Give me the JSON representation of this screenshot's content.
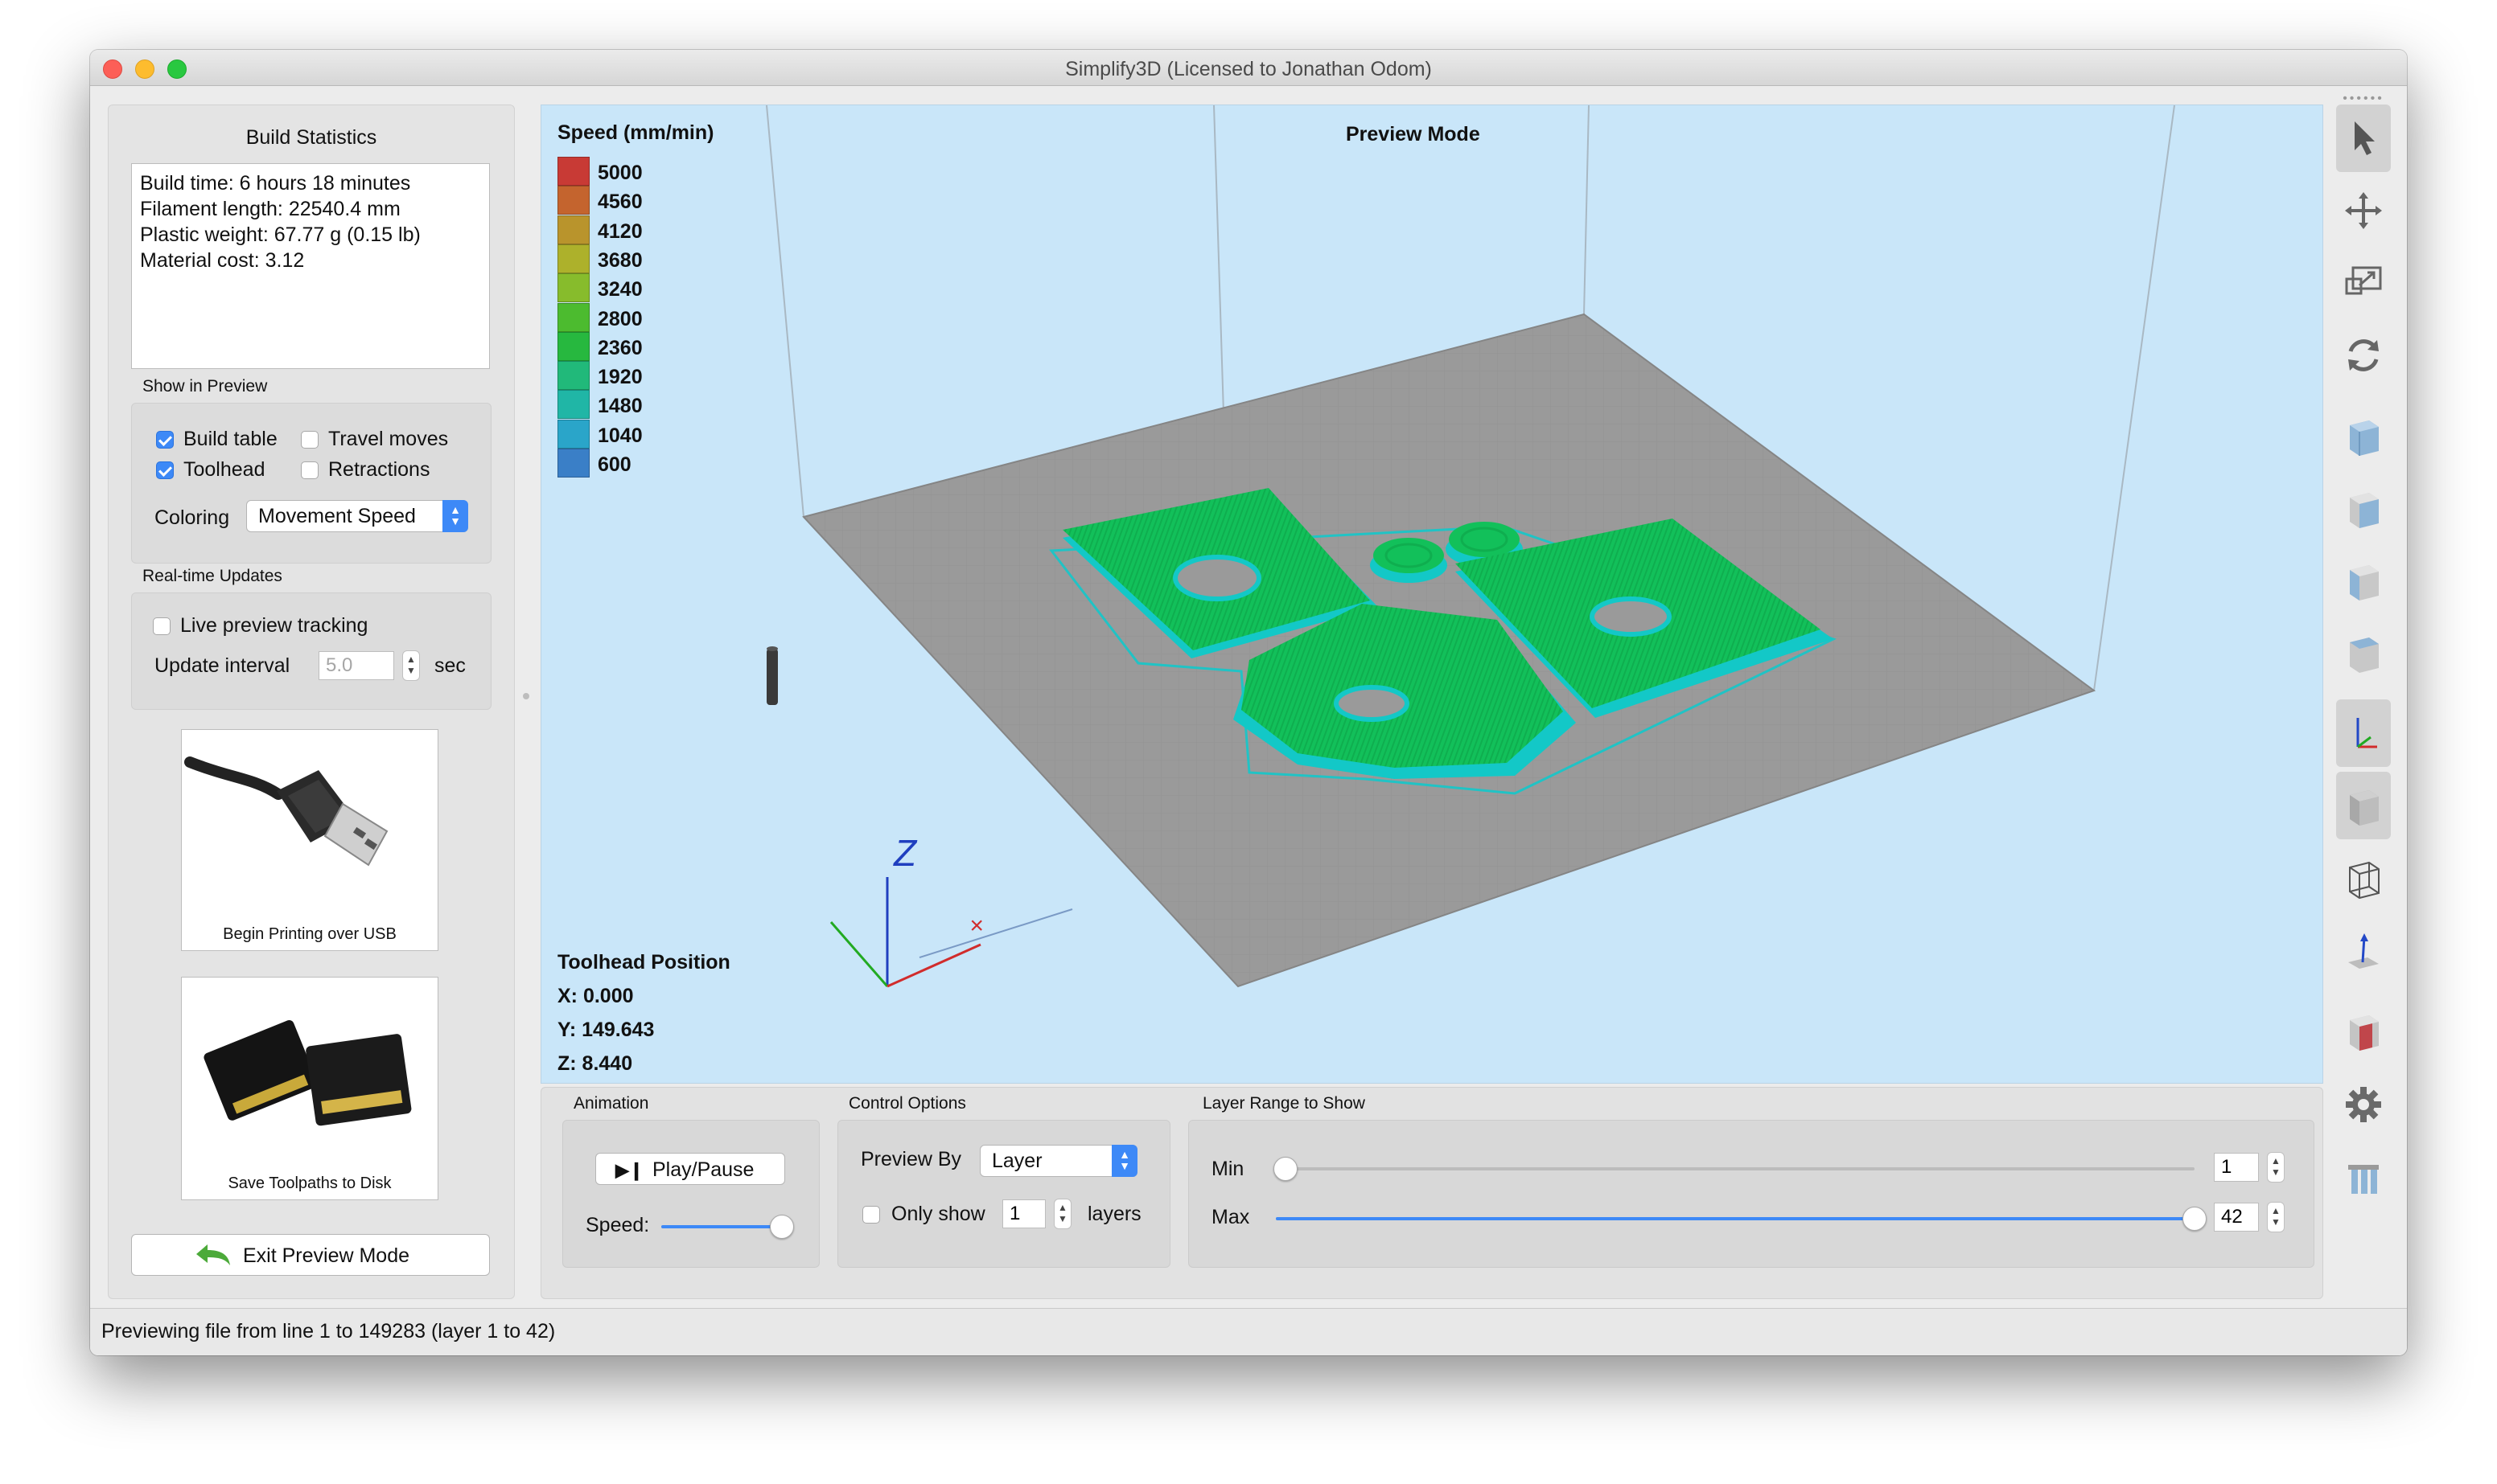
{
  "window": {
    "title": "Simplify3D (Licensed to Jonathan Odom)"
  },
  "build_stats": {
    "title": "Build Statistics",
    "lines": [
      "Build time: 6 hours 18 minutes",
      "Filament length: 22540.4 mm",
      "Plastic weight: 67.77 g (0.15 lb)",
      "Material cost: 3.12"
    ]
  },
  "show_in_preview": {
    "title": "Show in Preview",
    "build_table": {
      "label": "Build table",
      "checked": true
    },
    "travel_moves": {
      "label": "Travel moves",
      "checked": false
    },
    "toolhead": {
      "label": "Toolhead",
      "checked": true
    },
    "retractions": {
      "label": "Retractions",
      "checked": false
    },
    "coloring_label": "Coloring",
    "coloring_value": "Movement Speed"
  },
  "realtime": {
    "title": "Real-time Updates",
    "live_label": "Live preview tracking",
    "live_checked": false,
    "interval_label": "Update interval",
    "interval_value": "5.0",
    "interval_unit": "sec"
  },
  "cards": {
    "usb_caption": "Begin Printing over USB",
    "sd_caption": "Save Toolpaths to Disk"
  },
  "exit_button": "Exit Preview Mode",
  "viewport": {
    "preview_mode": "Preview Mode",
    "legend_title": "Speed (mm/min)",
    "legend": [
      {
        "value": "5000",
        "color": "#c83a35"
      },
      {
        "value": "4560",
        "color": "#c4642e"
      },
      {
        "value": "4120",
        "color": "#b9942c"
      },
      {
        "value": "3680",
        "color": "#adb12b"
      },
      {
        "value": "3240",
        "color": "#87bc2c"
      },
      {
        "value": "2800",
        "color": "#4cbb2f"
      },
      {
        "value": "2360",
        "color": "#27b83f"
      },
      {
        "value": "1920",
        "color": "#21b97a"
      },
      {
        "value": "1480",
        "color": "#20b6a6"
      },
      {
        "value": "1040",
        "color": "#2aa5c9"
      },
      {
        "value": "600",
        "color": "#3a7fc7"
      }
    ],
    "axis_z": "Z",
    "toolhead": {
      "title": "Toolhead Position",
      "x": "X: 0.000",
      "y": "Y: 149.643",
      "z": "Z: 8.440"
    }
  },
  "animation": {
    "title": "Animation",
    "play_label": "Play/Pause",
    "speed_label": "Speed:",
    "speed_level": 1.0
  },
  "control_options": {
    "title": "Control Options",
    "preview_by_label": "Preview By",
    "preview_by_value": "Layer",
    "only_show_label": "Only show",
    "only_show_value": "1",
    "only_show_checked": false,
    "layers_label": "layers"
  },
  "layer_range": {
    "title": "Layer Range to Show",
    "min_label": "Min",
    "min_value": "1",
    "max_label": "Max",
    "max_value": "42",
    "total_layers": 42
  },
  "status": "Previewing file from line 1 to 149283 (layer 1 to 42)",
  "toolbar": [
    "select-arrow-icon",
    "move-icon",
    "scale-icon",
    "rotate-icon",
    "iso-view-icon",
    "front-view-icon",
    "side-view-icon",
    "top-view-icon",
    "axes-icon",
    "solid-view-icon",
    "wireframe-view-icon",
    "normals-icon",
    "cross-section-icon",
    "settings-icon",
    "supports-icon"
  ]
}
